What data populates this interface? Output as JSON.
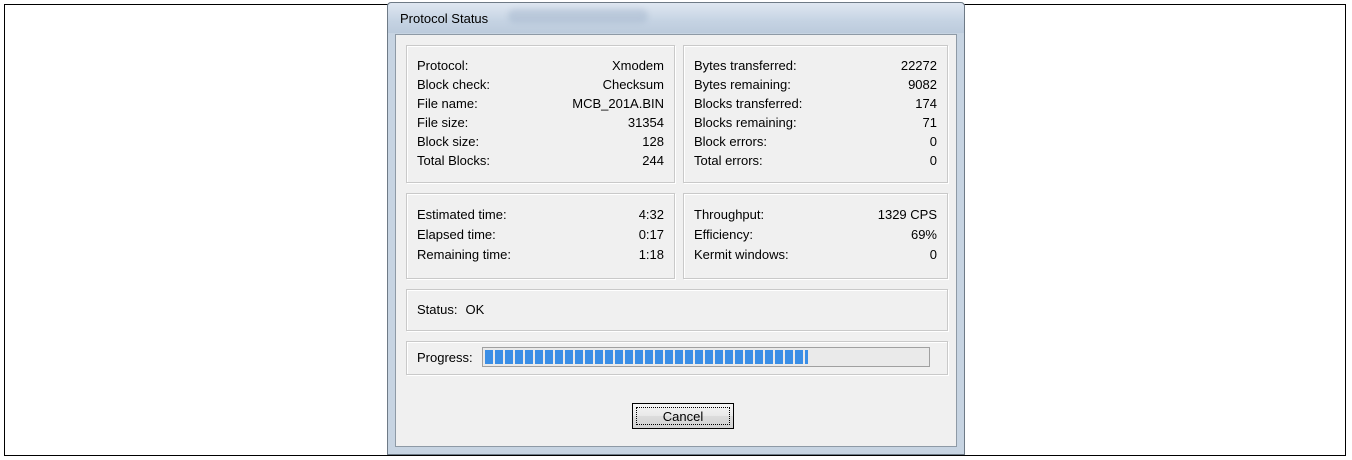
{
  "window": {
    "title": "Protocol Status"
  },
  "transfer_info": [
    {
      "label": "Protocol:",
      "value": "Xmodem"
    },
    {
      "label": "Block check:",
      "value": "Checksum"
    },
    {
      "label": "File name:",
      "value": "MCB_201A.BIN"
    },
    {
      "label": "File size:",
      "value": "31354"
    },
    {
      "label": "Block size:",
      "value": "128"
    },
    {
      "label": "Total Blocks:",
      "value": "244"
    }
  ],
  "transfer_stats": [
    {
      "label": "Bytes transferred:",
      "value": "22272"
    },
    {
      "label": "Bytes remaining:",
      "value": "9082"
    },
    {
      "label": "Blocks transferred:",
      "value": "174"
    },
    {
      "label": "Blocks remaining:",
      "value": "71"
    },
    {
      "label": "Block errors:",
      "value": "0"
    },
    {
      "label": "Total errors:",
      "value": "0"
    }
  ],
  "time_info": [
    {
      "label": "Estimated time:",
      "value": "4:32"
    },
    {
      "label": "Elapsed time:",
      "value": "0:17"
    },
    {
      "label": "Remaining time:",
      "value": "1:18"
    }
  ],
  "performance": [
    {
      "label": "Throughput:",
      "value": "1329 CPS"
    },
    {
      "label": "Efficiency:",
      "value": "69%"
    },
    {
      "label": "Kermit windows:",
      "value": "0"
    }
  ],
  "status": {
    "label": "Status:",
    "value": "OK"
  },
  "progress": {
    "label": "Progress:",
    "percent": 73
  },
  "buttons": {
    "cancel_label": "Cancel"
  },
  "colors": {
    "progress_fill": "#3a8ee6",
    "dialog_background": "#f0f0f0"
  }
}
